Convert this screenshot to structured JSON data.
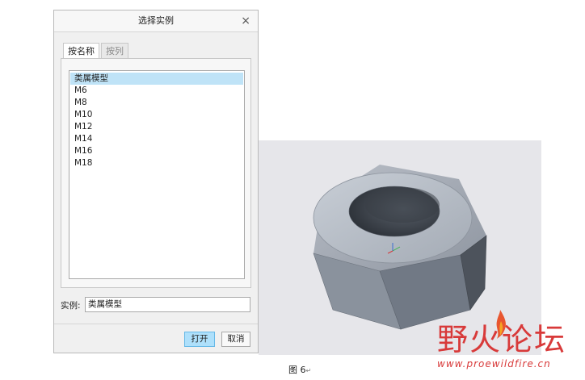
{
  "dialog": {
    "title": "选择实例",
    "close_glyph": "×",
    "tabs": [
      {
        "label": "按名称",
        "active": true
      },
      {
        "label": "按列",
        "active": false
      }
    ],
    "list_items": [
      {
        "label": "类属模型",
        "selected": true
      },
      {
        "label": "M6",
        "selected": false
      },
      {
        "label": "M8",
        "selected": false
      },
      {
        "label": "M10",
        "selected": false
      },
      {
        "label": "M12",
        "selected": false
      },
      {
        "label": "M14",
        "selected": false
      },
      {
        "label": "M16",
        "selected": false
      },
      {
        "label": "M18",
        "selected": false
      }
    ],
    "instance_label": "实例:",
    "instance_value": "类属模型",
    "open_label": "打开",
    "cancel_label": "取消"
  },
  "caption": "图 6",
  "caption_mark": "↵",
  "logo": {
    "text": "野火论坛",
    "url": "www.proewildfire.cn",
    "color": "#d83a3a"
  },
  "colors": {
    "selection": "#bfe3f7",
    "primary_button": "#aee0fb",
    "viewport_bg": "#e6e6ea",
    "nut_face": "#7d8793"
  }
}
